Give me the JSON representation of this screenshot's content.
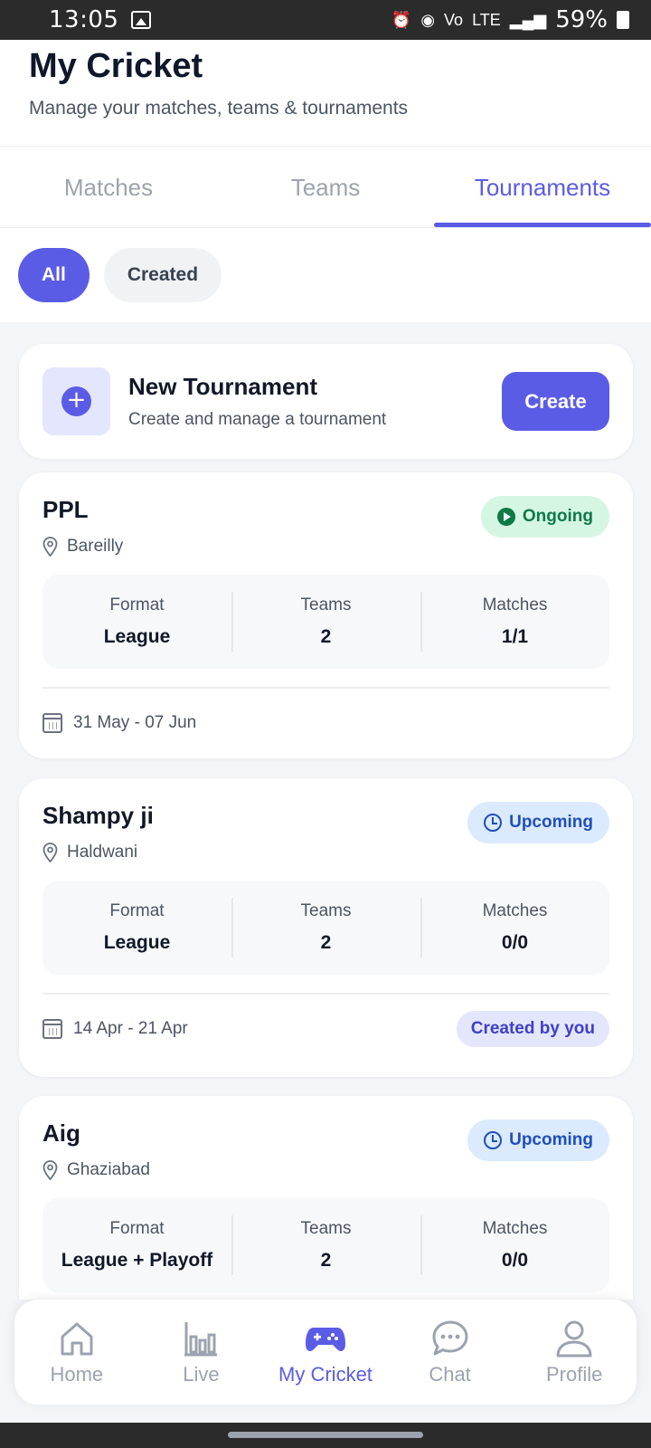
{
  "status_bar": {
    "time": "13:05",
    "battery": "59%",
    "network": "LTE"
  },
  "header": {
    "title": "My Cricket",
    "subtitle": "Manage your matches, teams & tournaments"
  },
  "tabs": [
    {
      "label": "Matches",
      "active": false
    },
    {
      "label": "Teams",
      "active": false
    },
    {
      "label": "Tournaments",
      "active": true
    }
  ],
  "filters": [
    {
      "label": "All",
      "active": true
    },
    {
      "label": "Created",
      "active": false
    }
  ],
  "new_tournament": {
    "title": "New Tournament",
    "subtitle": "Create and manage a tournament",
    "button": "Create"
  },
  "stat_labels": {
    "format": "Format",
    "teams": "Teams",
    "matches": "Matches"
  },
  "tournaments": [
    {
      "name": "PPL",
      "location": "Bareilly",
      "status": "Ongoing",
      "format": "League",
      "teams": "2",
      "matches": "1/1",
      "dates": "31 May - 07 Jun",
      "created_by_you": ""
    },
    {
      "name": "Shampy ji",
      "location": "Haldwani",
      "status": "Upcoming",
      "format": "League",
      "teams": "2",
      "matches": "0/0",
      "dates": "14 Apr - 21 Apr",
      "created_by_you": "Created by you"
    },
    {
      "name": "Aig",
      "location": "Ghaziabad",
      "status": "Upcoming",
      "format": "League + Playoff",
      "teams": "2",
      "matches": "0/0",
      "dates": "",
      "created_by_you": ""
    }
  ],
  "bottom_nav": [
    {
      "label": "Home",
      "icon": "home-icon",
      "active": false
    },
    {
      "label": "Live",
      "icon": "bar-chart-icon",
      "active": false
    },
    {
      "label": "My Cricket",
      "icon": "gamepad-icon",
      "active": true
    },
    {
      "label": "Chat",
      "icon": "chat-bubble-icon",
      "active": false
    },
    {
      "label": "Profile",
      "icon": "user-icon",
      "active": false
    }
  ],
  "colors": {
    "accent": "#5b5ce6",
    "ongoing_bg": "#d6f6e4",
    "ongoing_fg": "#0d7a47",
    "upcoming_bg": "#dbeafe",
    "upcoming_fg": "#1f4fb8"
  }
}
